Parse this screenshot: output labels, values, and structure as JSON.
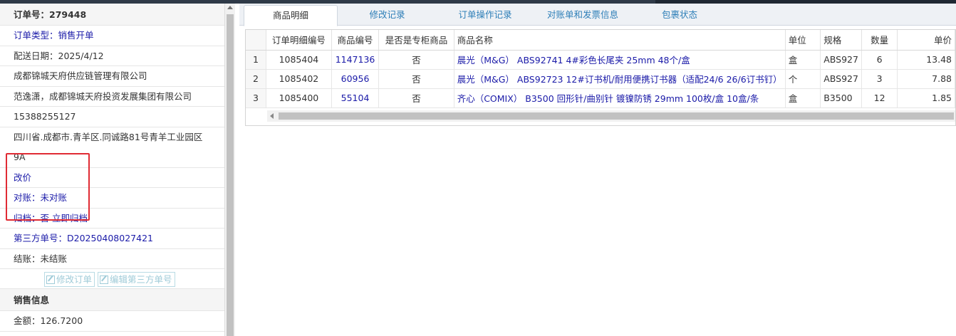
{
  "order": {
    "header": "订单号：279448",
    "type_label": "订单类型：",
    "type_value": "销售开单",
    "delivery_date": "配送日期：2025/4/12",
    "company": "成都锦城天府供应链管理有限公司",
    "contact": "范逸潇，成都锦城天府投资发展集团有限公司",
    "phone": "15388255127",
    "address_line1": "四川省.成都市.青羊区.同诚路81号青羊工业园区",
    "address_line2": "9A",
    "price_change": "改价",
    "reconcile_label": "对账：",
    "reconcile_value": "未对账",
    "archive": "归档：否 立即归档",
    "third_party_label": "第三方单号：",
    "third_party_value": "D20250408027421",
    "settlement": "结账：未结账",
    "btn_edit_order": "修改订单",
    "btn_edit_third": "编辑第三方单号",
    "sales_section": "销售信息",
    "amount": "金额：126.7200"
  },
  "tabs": [
    {
      "label": "商品明细",
      "active": true
    },
    {
      "label": "修改记录",
      "active": false
    },
    {
      "label": "订单操作记录",
      "active": false
    },
    {
      "label": "对账单和发票信息",
      "active": false
    },
    {
      "label": "包裹状态",
      "active": false
    }
  ],
  "grid": {
    "columns": [
      "",
      "订单明细编号",
      "商品编号",
      "是否是专柜商品",
      "商品名称",
      "单位",
      "规格",
      "数量",
      "单价"
    ],
    "rows": [
      [
        "1",
        "1085404",
        "1147136",
        "否",
        "晨光（M&G） ABS92741 4#彩色长尾夹 25mm 48个/盒",
        "盒",
        "ABS927",
        "6",
        "13.48"
      ],
      [
        "2",
        "1085402",
        "60956",
        "否",
        "晨光（M&G） ABS92723 12#订书机/耐用便携订书器（适配24/6 26/6订书钉）",
        "个",
        "ABS927",
        "3",
        "7.88"
      ],
      [
        "3",
        "1085400",
        "55104",
        "否",
        "齐心（COMIX） B3500 回形针/曲别针 镀镍防锈 29mm 100枚/盒 10盒/条",
        "盒",
        "B3500",
        "12",
        "1.85"
      ]
    ]
  },
  "colors": {
    "link": "#1a1aa8",
    "highlight": "#e02b34",
    "tab_text": "#2e7fb8"
  }
}
